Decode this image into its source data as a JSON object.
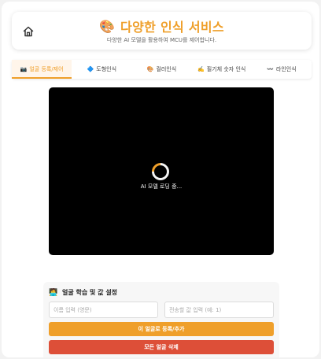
{
  "header": {
    "title_emoji": "🎨",
    "title": "다양한 인식 서비스",
    "subtitle": "다양한 AI 모델을 활용하여 MCU를 제어합니다."
  },
  "tabs": [
    {
      "icon": "📷",
      "label": "얼굴 등록/제어",
      "active": true
    },
    {
      "icon": "🔷",
      "label": "도형인식",
      "active": false
    },
    {
      "icon": "🎨",
      "label": "컬러인식",
      "active": false
    },
    {
      "icon": "✍️",
      "label": "필기체 숫자 인식",
      "active": false
    },
    {
      "icon": "〰️",
      "label": "라인인식",
      "active": false
    }
  ],
  "video": {
    "loading_text": "AI 모델 로딩 중..."
  },
  "panel": {
    "icon": "🧑‍💻",
    "title": "얼굴 학습 및 값 설정",
    "name_placeholder": "이름 입력 (영문)",
    "value_placeholder": "전송할 값 입력 (예: 1)",
    "register_label": "이 얼굴로 등록/추가",
    "delete_label": "모든 얼굴 삭제"
  },
  "colors": {
    "accent": "#ef9f2a",
    "danger": "#dd4f38"
  }
}
